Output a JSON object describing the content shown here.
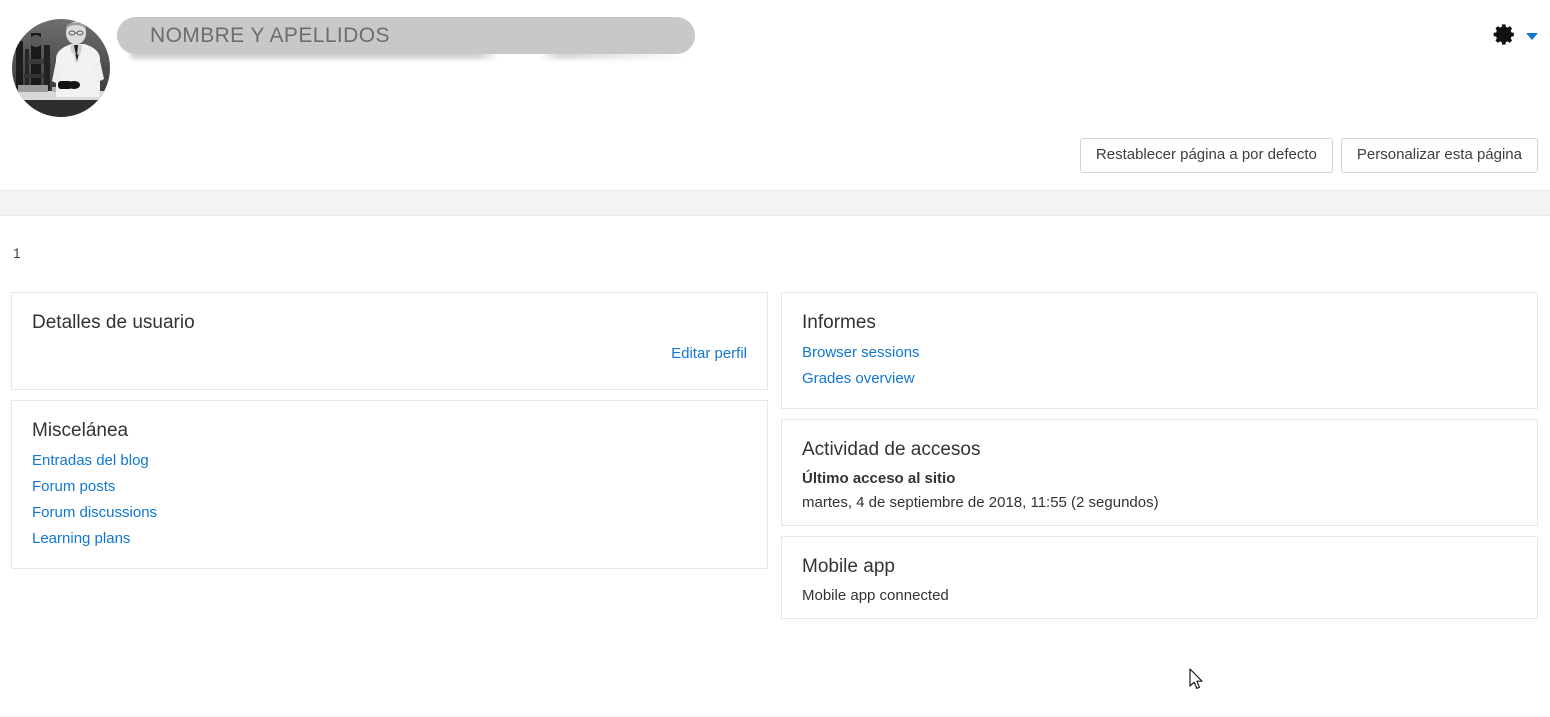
{
  "header": {
    "user_name_redacted": "NOMBRE Y APELLIDOS",
    "avatar_alt": "user-profile-photo",
    "gear_icon": "gear-icon",
    "caret_icon": "chevron-down-icon",
    "buttons": {
      "reset_page": "Restablecer página a por defecto",
      "customize_page": "Personalizar esta página"
    }
  },
  "region": {
    "label": "1"
  },
  "left_column": [
    {
      "title": "Detalles de usuario",
      "edit_link": "Editar perfil",
      "links": []
    },
    {
      "title": "Miscelánea",
      "links": [
        "Entradas del blog",
        "Forum posts",
        "Forum discussions",
        "Learning plans"
      ]
    }
  ],
  "right_column": {
    "informes": {
      "title": "Informes",
      "links": [
        "Browser sessions",
        "Grades overview"
      ]
    },
    "actividad": {
      "title": "Actividad de accesos",
      "label": "Último acceso al sitio",
      "value": "martes, 4 de septiembre de 2018, 11:55  (2 segundos)"
    },
    "mobile": {
      "title": "Mobile app",
      "status": "Mobile app connected"
    }
  },
  "colors": {
    "link": "#1177d1",
    "text": "#333333",
    "card_border": "#e6e7e9",
    "band": "#f3f4f5",
    "redaction": "#c9c7c7"
  }
}
